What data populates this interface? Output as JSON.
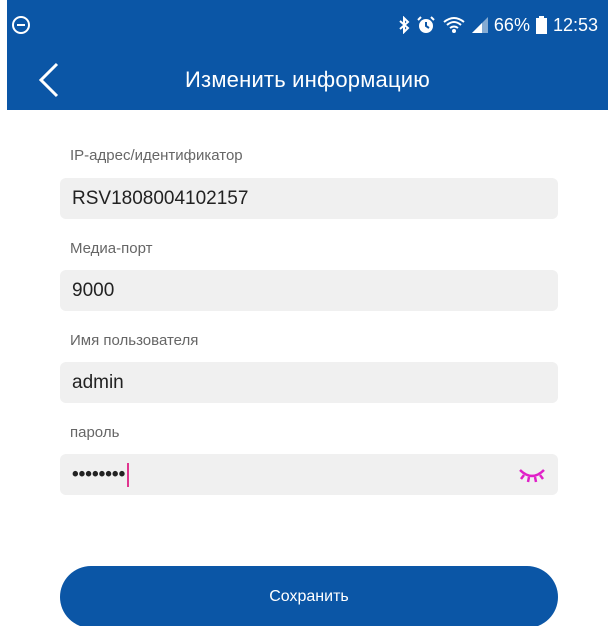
{
  "status_bar": {
    "battery": "66%",
    "time": "12:53",
    "icons": [
      "do-not-disturb-icon",
      "bluetooth-icon",
      "alarm-icon",
      "wifi-icon",
      "signal-icon",
      "battery-icon"
    ]
  },
  "header": {
    "title": "Изменить информацию"
  },
  "form": {
    "ip": {
      "label": "IP-адрес/идентификатор",
      "value": "RSV1808004102157"
    },
    "port": {
      "label": "Медиа-порт",
      "value": "9000"
    },
    "username": {
      "label": "Имя пользователя",
      "value": "admin"
    },
    "password": {
      "label": "пароль",
      "value": "••••••••"
    }
  },
  "actions": {
    "save_label": "Сохранить"
  },
  "colors": {
    "primary": "#0b56a6",
    "field_bg": "#f0f0f0",
    "accent": "#e0358f",
    "eye": "#e020c8"
  }
}
